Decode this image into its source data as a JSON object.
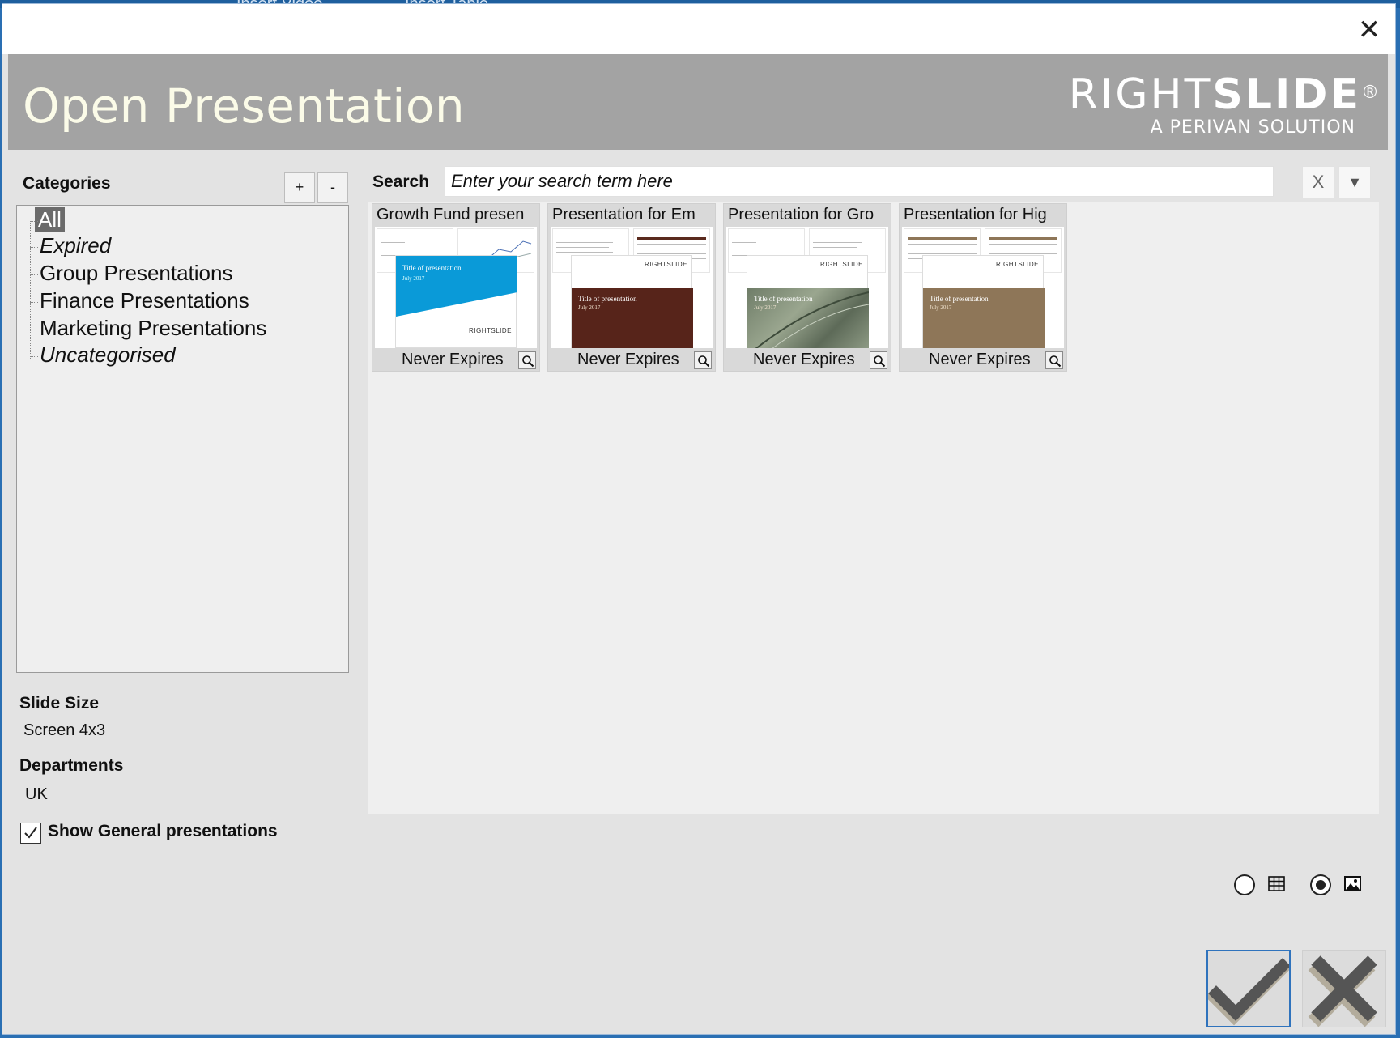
{
  "background_tabs": [
    "Insert Video",
    "Insert Table"
  ],
  "window": {
    "close_glyph": "✕"
  },
  "banner": {
    "title": "Open Presentation",
    "logo_main_light": "RIGHT",
    "logo_main_bold": "SLIDE",
    "logo_registered": "®",
    "logo_sub": "A PERIVAN SOLUTION"
  },
  "categories": {
    "header": "Categories",
    "add_label": "+",
    "remove_label": "-",
    "items": [
      {
        "label": "All",
        "selected": true,
        "italic": false
      },
      {
        "label": "Expired",
        "selected": false,
        "italic": true
      },
      {
        "label": "Group Presentations",
        "selected": false,
        "italic": false
      },
      {
        "label": "Finance Presentations",
        "selected": false,
        "italic": false
      },
      {
        "label": "Marketing Presentations",
        "selected": false,
        "italic": false
      },
      {
        "label": "Uncategorised",
        "selected": false,
        "italic": true
      }
    ]
  },
  "slide_size": {
    "label": "Slide Size",
    "value": "Screen 4x3"
  },
  "departments": {
    "label": "Departments",
    "value": "UK"
  },
  "show_general": {
    "label": "Show General presentations",
    "checked": true
  },
  "search": {
    "label": "Search",
    "placeholder": "Enter your search term here",
    "clear_label": "X",
    "dropdown_glyph": "▼"
  },
  "presentations": [
    {
      "title": "Growth Fund presen",
      "expiry": "Never Expires",
      "front_title": "Title of presentation",
      "front_date": "July 2017",
      "front_logo": "RIGHTSLIDE",
      "color": "#0a9ad8"
    },
    {
      "title": "Presentation for Em",
      "expiry": "Never Expires",
      "front_title": "Title of presentation",
      "front_date": "July 2017",
      "front_logo": "RIGHTSLIDE",
      "color": "#57241a"
    },
    {
      "title": "Presentation for Gro",
      "expiry": "Never Expires",
      "front_title": "Title of presentation",
      "front_date": "July 2017",
      "front_logo": "RIGHTSLIDE",
      "color": "#7d8a74"
    },
    {
      "title": "Presentation for Hig",
      "expiry": "Never Expires",
      "front_title": "Title of presentation",
      "front_date": "July 2017",
      "front_logo": "RIGHTSLIDE",
      "color": "#8e7658"
    }
  ],
  "view_mode": {
    "selected": "thumbnail",
    "options": [
      "grid-icon",
      "image-icon"
    ]
  },
  "colors": {
    "banner": "#a3a3a3",
    "banner_title": "#fbfbe8",
    "ok_border": "#2f73bd",
    "dialog": "#e3e3e3"
  }
}
